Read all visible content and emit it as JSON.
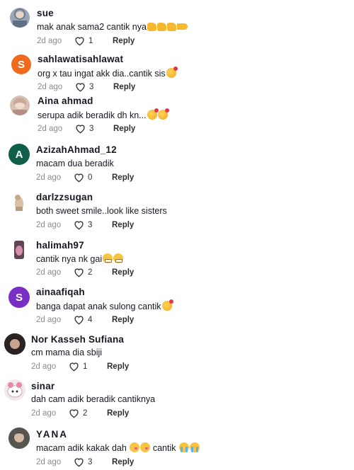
{
  "comments": [
    {
      "username": "sue",
      "text": "mak anak sama2 cantik nya",
      "date": "2d ago",
      "likes": "1",
      "reply": "Reply",
      "avatar_letter": "",
      "avatar_color": "#9aa7b8"
    },
    {
      "username": "sahlawatisahlawat",
      "text": "org x tau ingat akk dia..cantik sis",
      "date": "2d ago",
      "likes": "3",
      "reply": "Reply",
      "avatar_letter": "S",
      "avatar_color": "#f06a1e"
    },
    {
      "username": "Aina ahmad",
      "text": "serupa adik beradik dh kn...",
      "date": "2d ago",
      "likes": "3",
      "reply": "Reply",
      "avatar_letter": "",
      "avatar_color": "#d8c1b0"
    },
    {
      "username": "AzizahAhmad_12",
      "text": "macam dua beradik",
      "date": "2d ago",
      "likes": "0",
      "reply": "Reply",
      "avatar_letter": "A",
      "avatar_color": "#0e5e4a"
    },
    {
      "username": "darlzzsugan",
      "text": "both sweet smile..look like sisters",
      "date": "2d ago",
      "likes": "3",
      "reply": "Reply",
      "avatar_letter": "",
      "avatar_color": "#d9cbb8"
    },
    {
      "username": "halimah97",
      "text": "cantik nya nk gai",
      "date": "2d ago",
      "likes": "2",
      "reply": "Reply",
      "avatar_letter": "",
      "avatar_color": "#8a6b80"
    },
    {
      "username": "ainaafiqah",
      "text": "banga dapat anak sulong cantik",
      "date": "2d ago",
      "likes": "4",
      "reply": "Reply",
      "avatar_letter": "S",
      "avatar_color": "#7a2fc4"
    },
    {
      "username": "Nor Kasseh Sufiana",
      "text": "cm mama dia sbiji",
      "date": "2d ago",
      "likes": "1",
      "reply": "Reply",
      "avatar_letter": "",
      "avatar_color": "#3a2e2e"
    },
    {
      "username": "sinar",
      "text": "dah cam adik beradik cantiknya",
      "date": "2d ago",
      "likes": "2",
      "reply": "Reply",
      "avatar_letter": "",
      "avatar_color": "#e7d6df"
    },
    {
      "username": "YANA",
      "text": "macam adik kakak dah",
      "text2": "cantik",
      "date": "2d ago",
      "likes": "3",
      "reply": "Reply",
      "avatar_letter": "",
      "avatar_color": "#6b6763"
    }
  ]
}
